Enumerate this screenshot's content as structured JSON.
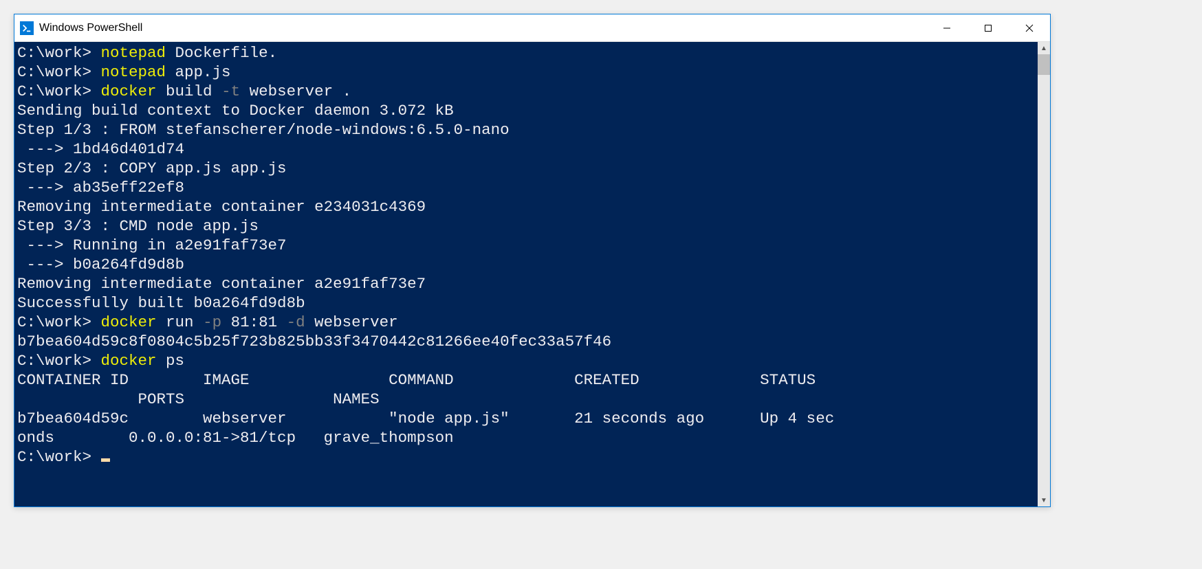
{
  "window": {
    "title": "Windows PowerShell"
  },
  "terminal": {
    "lines": [
      {
        "prompt": "C:\\work> ",
        "parts": [
          {
            "text": "notepad",
            "cls": "cmd-yellow"
          },
          {
            "text": " Dockerfile.",
            "cls": "cmd-white"
          }
        ]
      },
      {
        "prompt": "C:\\work> ",
        "parts": [
          {
            "text": "notepad",
            "cls": "cmd-yellow"
          },
          {
            "text": " app.js",
            "cls": "cmd-white"
          }
        ]
      },
      {
        "prompt": "C:\\work> ",
        "parts": [
          {
            "text": "docker",
            "cls": "cmd-yellow"
          },
          {
            "text": " build ",
            "cls": "cmd-white"
          },
          {
            "text": "-t",
            "cls": "cmd-gray"
          },
          {
            "text": " webserver .",
            "cls": "cmd-white"
          }
        ]
      },
      {
        "prompt": "",
        "parts": [
          {
            "text": "Sending build context to Docker daemon 3.072 kB",
            "cls": "cmd-white"
          }
        ]
      },
      {
        "prompt": "",
        "parts": [
          {
            "text": "Step 1/3 : FROM stefanscherer/node-windows:6.5.0-nano",
            "cls": "cmd-white"
          }
        ]
      },
      {
        "prompt": "",
        "parts": [
          {
            "text": " ---> 1bd46d401d74",
            "cls": "cmd-white"
          }
        ]
      },
      {
        "prompt": "",
        "parts": [
          {
            "text": "Step 2/3 : COPY app.js app.js",
            "cls": "cmd-white"
          }
        ]
      },
      {
        "prompt": "",
        "parts": [
          {
            "text": " ---> ab35eff22ef8",
            "cls": "cmd-white"
          }
        ]
      },
      {
        "prompt": "",
        "parts": [
          {
            "text": "Removing intermediate container e234031c4369",
            "cls": "cmd-white"
          }
        ]
      },
      {
        "prompt": "",
        "parts": [
          {
            "text": "Step 3/3 : CMD node app.js",
            "cls": "cmd-white"
          }
        ]
      },
      {
        "prompt": "",
        "parts": [
          {
            "text": " ---> Running in a2e91faf73e7",
            "cls": "cmd-white"
          }
        ]
      },
      {
        "prompt": "",
        "parts": [
          {
            "text": " ---> b0a264fd9d8b",
            "cls": "cmd-white"
          }
        ]
      },
      {
        "prompt": "",
        "parts": [
          {
            "text": "Removing intermediate container a2e91faf73e7",
            "cls": "cmd-white"
          }
        ]
      },
      {
        "prompt": "",
        "parts": [
          {
            "text": "Successfully built b0a264fd9d8b",
            "cls": "cmd-white"
          }
        ]
      },
      {
        "prompt": "C:\\work> ",
        "parts": [
          {
            "text": "docker",
            "cls": "cmd-yellow"
          },
          {
            "text": " run ",
            "cls": "cmd-white"
          },
          {
            "text": "-p",
            "cls": "cmd-gray"
          },
          {
            "text": " 81:81 ",
            "cls": "cmd-white"
          },
          {
            "text": "-d",
            "cls": "cmd-gray"
          },
          {
            "text": " webserver",
            "cls": "cmd-white"
          }
        ]
      },
      {
        "prompt": "",
        "parts": [
          {
            "text": "b7bea604d59c8f0804c5b25f723b825bb33f3470442c81266ee40fec33a57f46",
            "cls": "cmd-white"
          }
        ]
      },
      {
        "prompt": "C:\\work> ",
        "parts": [
          {
            "text": "docker",
            "cls": "cmd-yellow"
          },
          {
            "text": " ps",
            "cls": "cmd-white"
          }
        ]
      },
      {
        "prompt": "",
        "parts": [
          {
            "text": "CONTAINER ID        IMAGE               COMMAND             CREATED             STATUS",
            "cls": "cmd-white"
          }
        ]
      },
      {
        "prompt": "",
        "parts": [
          {
            "text": "             PORTS                NAMES",
            "cls": "cmd-white"
          }
        ]
      },
      {
        "prompt": "",
        "parts": [
          {
            "text": "b7bea604d59c        webserver           \"node app.js\"       21 seconds ago      Up 4 sec",
            "cls": "cmd-white"
          }
        ]
      },
      {
        "prompt": "",
        "parts": [
          {
            "text": "onds        0.0.0.0:81->81/tcp   grave_thompson",
            "cls": "cmd-white"
          }
        ]
      },
      {
        "prompt": "C:\\work> ",
        "parts": [],
        "cursor": true
      }
    ]
  }
}
